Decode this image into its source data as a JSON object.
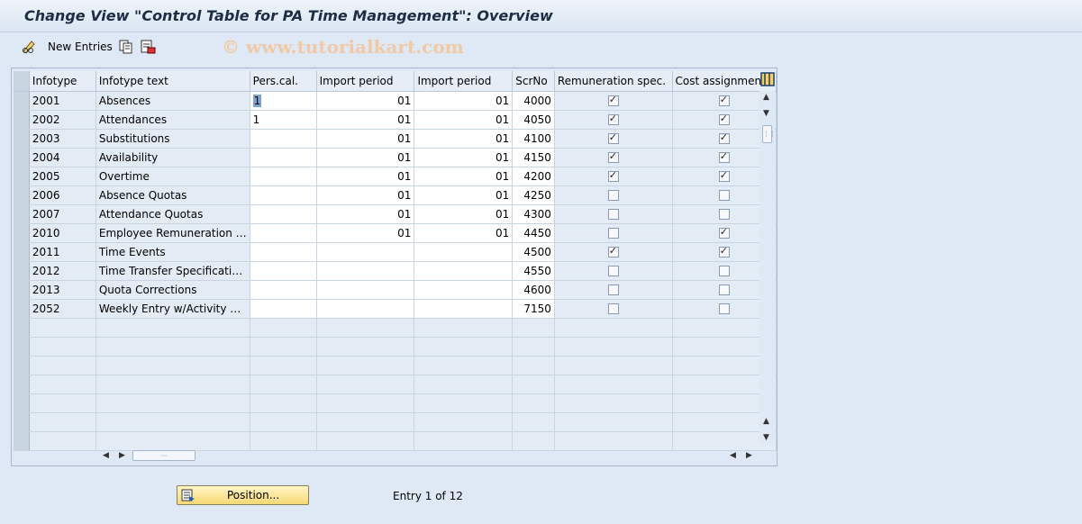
{
  "window": {
    "title": "Change View \"Control Table for PA Time Management\": Overview"
  },
  "toolbar": {
    "new_entries_label": "New Entries",
    "icons": [
      "pencil-glasses-icon",
      "copy-icon",
      "delimit-icon"
    ]
  },
  "watermark": "© www.tutorialkart.com",
  "table": {
    "columns": [
      "Infotype",
      "Infotype text",
      "Pers.cal.",
      "Import period",
      "Import period",
      "ScrNo",
      "Remuneration spec.",
      "Cost assignment"
    ],
    "rows": [
      {
        "infotype": "2001",
        "text": "Absences",
        "perscal": "1",
        "imp1": "01",
        "imp2": "01",
        "scrno": "4000",
        "remun": true,
        "cost": true
      },
      {
        "infotype": "2002",
        "text": "Attendances",
        "perscal": "1",
        "imp1": "01",
        "imp2": "01",
        "scrno": "4050",
        "remun": true,
        "cost": true
      },
      {
        "infotype": "2003",
        "text": "Substitutions",
        "perscal": "",
        "imp1": "01",
        "imp2": "01",
        "scrno": "4100",
        "remun": true,
        "cost": true
      },
      {
        "infotype": "2004",
        "text": "Availability",
        "perscal": "",
        "imp1": "01",
        "imp2": "01",
        "scrno": "4150",
        "remun": true,
        "cost": true
      },
      {
        "infotype": "2005",
        "text": "Overtime",
        "perscal": "",
        "imp1": "01",
        "imp2": "01",
        "scrno": "4200",
        "remun": true,
        "cost": true
      },
      {
        "infotype": "2006",
        "text": "Absence Quotas",
        "perscal": "",
        "imp1": "01",
        "imp2": "01",
        "scrno": "4250",
        "remun": false,
        "cost": false
      },
      {
        "infotype": "2007",
        "text": "Attendance Quotas",
        "perscal": "",
        "imp1": "01",
        "imp2": "01",
        "scrno": "4300",
        "remun": false,
        "cost": false
      },
      {
        "infotype": "2010",
        "text": "Employee Remuneration …",
        "perscal": "",
        "imp1": "01",
        "imp2": "01",
        "scrno": "4450",
        "remun": false,
        "cost": true
      },
      {
        "infotype": "2011",
        "text": "Time Events",
        "perscal": "",
        "imp1": "",
        "imp2": "",
        "scrno": "4500",
        "remun": true,
        "cost": true
      },
      {
        "infotype": "2012",
        "text": "Time Transfer Specificati…",
        "perscal": "",
        "imp1": "",
        "imp2": "",
        "scrno": "4550",
        "remun": false,
        "cost": false
      },
      {
        "infotype": "2013",
        "text": "Quota Corrections",
        "perscal": "",
        "imp1": "",
        "imp2": "",
        "scrno": "4600",
        "remun": false,
        "cost": false
      },
      {
        "infotype": "2052",
        "text": "Weekly Entry w/Activity …",
        "perscal": "",
        "imp1": "",
        "imp2": "",
        "scrno": "7150",
        "remun": false,
        "cost": false
      }
    ],
    "empty_rows": 7
  },
  "footer": {
    "position_button_label": "Position...",
    "entry_info": "Entry 1 of 12"
  }
}
